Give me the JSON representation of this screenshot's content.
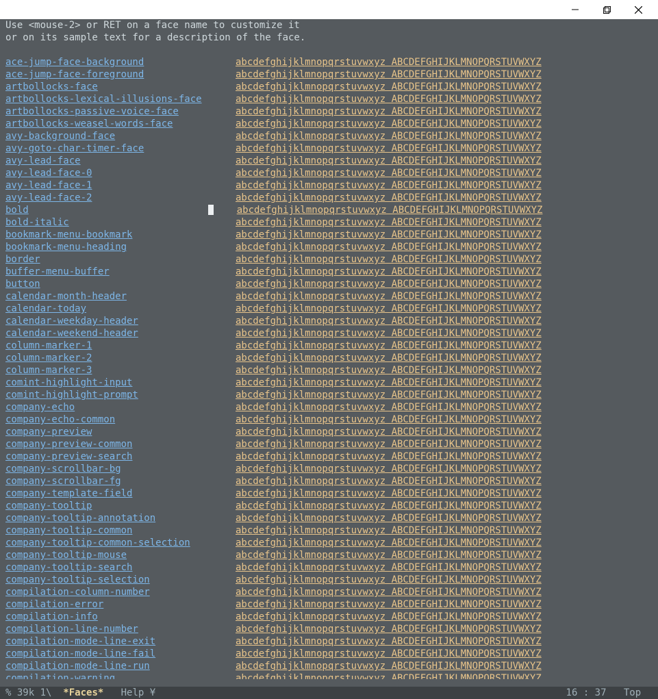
{
  "help": {
    "line1": "Use <mouse-2> or RET on a face name to customize it",
    "line2": "or on its sample text for a description of the face."
  },
  "sample": "abcdefghijklmnopqrstuvwxyz ABCDEFGHIJKLMNOPQRSTUVWXYZ",
  "cursor_row_face": "bold",
  "faces": [
    "ace-jump-face-background",
    "ace-jump-face-foreground",
    "artbollocks-face",
    "artbollocks-lexical-illusions-face",
    "artbollocks-passive-voice-face",
    "artbollocks-weasel-words-face",
    "avy-background-face",
    "avy-goto-char-timer-face",
    "avy-lead-face",
    "avy-lead-face-0",
    "avy-lead-face-1",
    "avy-lead-face-2",
    "bold",
    "bold-italic",
    "bookmark-menu-bookmark",
    "bookmark-menu-heading",
    "border",
    "buffer-menu-buffer",
    "button",
    "calendar-month-header",
    "calendar-today",
    "calendar-weekday-header",
    "calendar-weekend-header",
    "column-marker-1",
    "column-marker-2",
    "column-marker-3",
    "comint-highlight-input",
    "comint-highlight-prompt",
    "company-echo",
    "company-echo-common",
    "company-preview",
    "company-preview-common",
    "company-preview-search",
    "company-scrollbar-bg",
    "company-scrollbar-fg",
    "company-template-field",
    "company-tooltip",
    "company-tooltip-annotation",
    "company-tooltip-common",
    "company-tooltip-common-selection",
    "company-tooltip-mouse",
    "company-tooltip-search",
    "company-tooltip-selection",
    "compilation-column-number",
    "compilation-error",
    "compilation-info",
    "compilation-line-number",
    "compilation-mode-line-exit",
    "compilation-mode-line-fail",
    "compilation-mode-line-run",
    "compilation-warning"
  ],
  "modeline": {
    "left": "% 39k 1\\",
    "buffer_name": "*Faces*",
    "mode": "Help ¥",
    "position": "16 : 37",
    "scroll": "Top"
  },
  "colors": {
    "link": "#7db6e8",
    "sample": "#e8c48a",
    "bg": "#555a5e",
    "text": "#cfd8dc"
  }
}
